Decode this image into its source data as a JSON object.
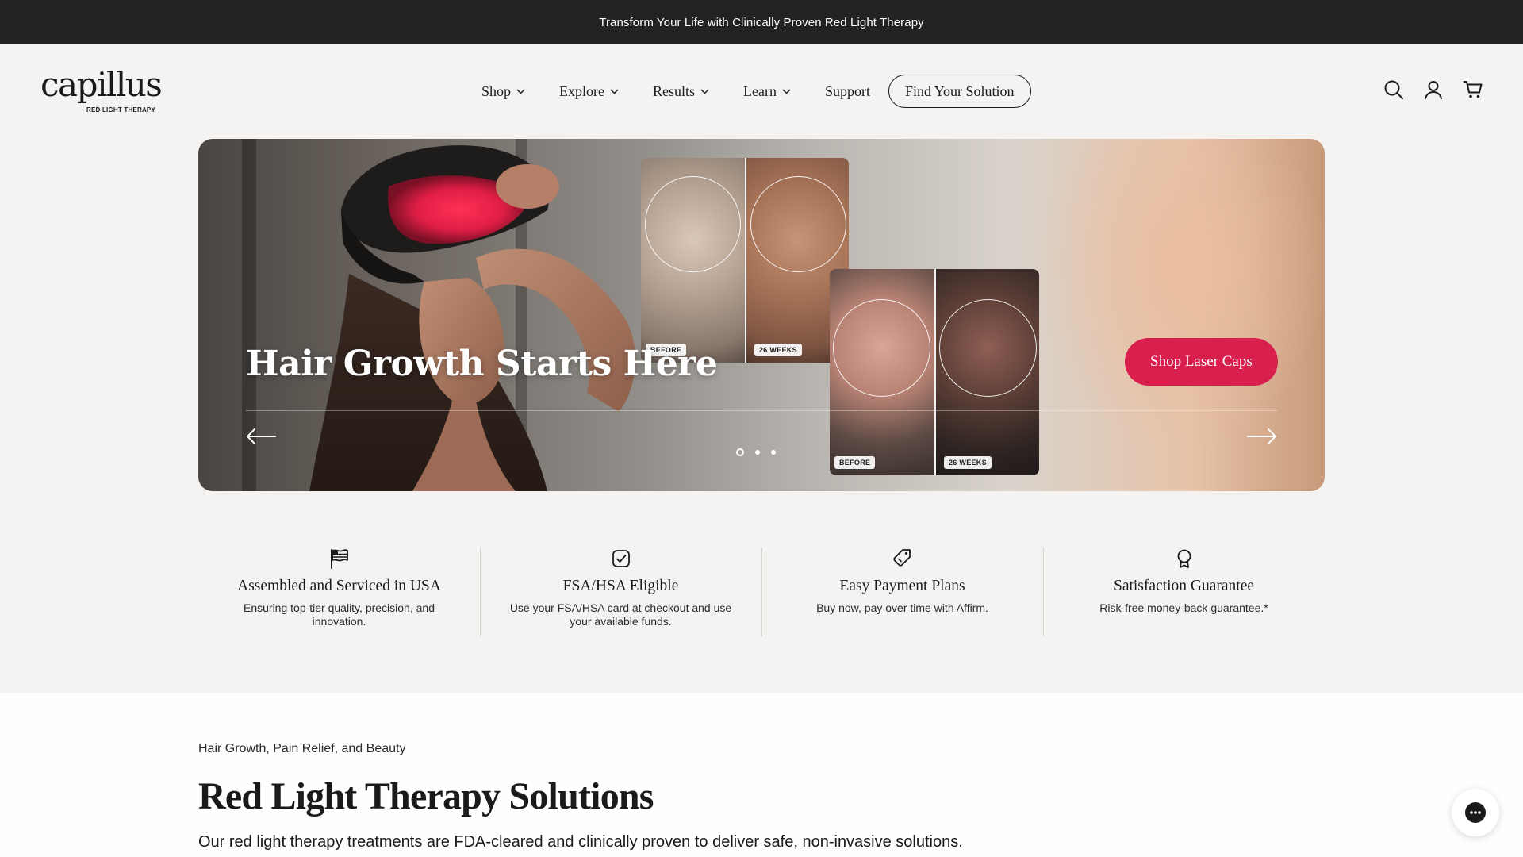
{
  "announcement": "Transform Your Life with Clinically Proven Red Light Therapy",
  "logo": {
    "word": "capillus",
    "sub": "RED LIGHT THERAPY"
  },
  "nav": {
    "items": [
      {
        "label": "Shop",
        "dropdown": true
      },
      {
        "label": "Explore",
        "dropdown": true
      },
      {
        "label": "Results",
        "dropdown": true
      },
      {
        "label": "Learn",
        "dropdown": true
      },
      {
        "label": "Support",
        "dropdown": false
      }
    ],
    "cta": "Find Your Solution"
  },
  "header_icons": [
    "search-icon",
    "account-icon",
    "cart-icon"
  ],
  "hero": {
    "title": "Hair Growth Starts Here",
    "button": "Shop Laser Caps",
    "button_color": "#d91f4e",
    "slides": 3,
    "active_slide": 1,
    "comparisons": [
      {
        "before_label": "BEFORE",
        "after_label": "26 WEEKS"
      },
      {
        "before_label": "BEFORE",
        "after_label": "26 WEEKS"
      }
    ]
  },
  "features": [
    {
      "icon": "flag-icon",
      "title": "Assembled and Serviced in USA",
      "desc": "Ensuring top-tier quality, precision, and innovation."
    },
    {
      "icon": "checkbox-icon",
      "title": "FSA/HSA Eligible",
      "desc": "Use your FSA/HSA card at checkout and use your available funds."
    },
    {
      "icon": "tag-icon",
      "title": "Easy Payment Plans",
      "desc": "Buy now, pay over time with Affirm."
    },
    {
      "icon": "award-icon",
      "title": "Satisfaction Guarantee",
      "desc": "Risk-free money-back guarantee.*"
    }
  ],
  "section": {
    "eyebrow": "Hair Growth, Pain Relief, and Beauty",
    "title": "Red Light Therapy Solutions",
    "desc": "Our red light therapy treatments are FDA-cleared and clinically proven to deliver safe, non-invasive solutions."
  },
  "chat_icon": "chat-icon"
}
